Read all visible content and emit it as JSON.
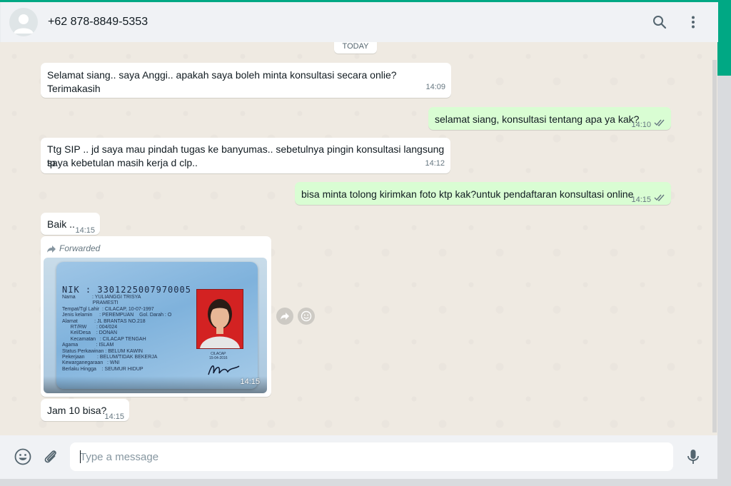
{
  "header": {
    "contact_name": "+62 878-8849-5353"
  },
  "date_chip": "TODAY",
  "messages": [
    {
      "text": "Selamat siang.. saya Anggi.. apakah saya boleh minta konsultasi secara onlie? Terimakasih",
      "time": "14:09"
    },
    {
      "text": "selamat siang, konsultasi tentang apa ya kak?",
      "time": "14:10"
    },
    {
      "line1": "Ttg SIP .. jd saya mau pindah tugas ke banyumas.. sebetulnya pingin konsultasi langsung tp",
      "line2": "saya kebetulan masih kerja d clp..",
      "time": "14:12"
    },
    {
      "text": "bisa minta tolong kirimkan foto ktp kak?untuk pendaftaran konsultasi online",
      "time": "14:15"
    },
    {
      "text": "Baik ..",
      "time": "14:15"
    },
    {
      "forwarded_label": "Forwarded",
      "time": "14:15"
    },
    {
      "text": "Jam 10 bisa?",
      "time": "14:15"
    }
  ],
  "ktp": {
    "nik": "NIK  : 3301225007970005",
    "lines": "Nama            : YULIANGGI TRISYA\n                      PRAMESTI\nTempat/Tgl Lahir  : CILACAP, 10-07-1997\nJenis kelamin     : PEREMPUAN    Gol. Darah : O\nAlamat            : JL BRANTAS NO.218\n      RT/RW       : 004/024\n      Kel/Desa    : DONAN\n      Kecamatan   : CILACAP TENGAH\nAgama             : ISLAM\nStatus Perkawinan : BELUM KAWIN\nPekerjaan         : BELUM/TIDAK BEKERJA\nKewarganegaraan   : WNI\nBerlaku Hingga    : SEUMUR HIDUP",
    "issue_place": "CILACAP",
    "issue_date": "15-04-2016"
  },
  "composer": {
    "placeholder": "Type a message"
  },
  "colors": {
    "accent": "#00a884",
    "incoming": "#ffffff",
    "outgoing": "#d9fdd3",
    "chat_bg": "#efeae2"
  },
  "icons": {
    "search": "search-icon",
    "menu": "menu-icon",
    "emoji": "emoji-icon",
    "attach": "attach-icon",
    "mic": "mic-icon",
    "forward": "forward-icon",
    "read": "double-check-icon"
  }
}
